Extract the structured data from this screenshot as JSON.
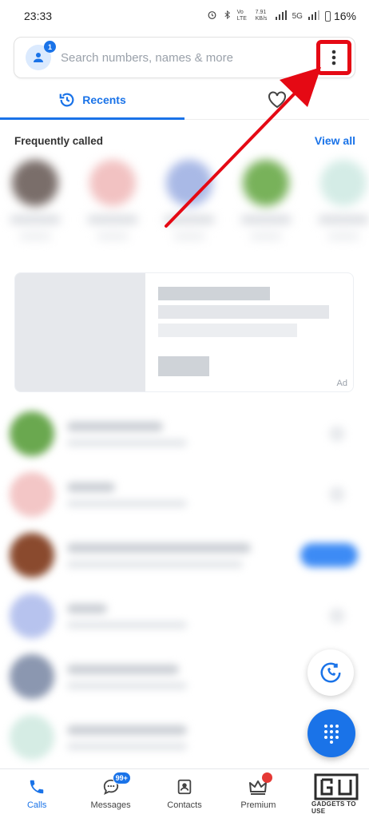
{
  "status_bar": {
    "time": "23:33",
    "network_speed": "7.91\nKB/s",
    "lte_label": "Vo LTE",
    "five_g": "5G",
    "battery": "16%"
  },
  "search": {
    "placeholder": "Search numbers, names & more",
    "profile_badge": "1"
  },
  "tabs": [
    {
      "label": "Recents",
      "active": true
    }
  ],
  "frequently_called": {
    "title": "Frequently called",
    "view_all": "View all"
  },
  "ad": {
    "label": "Ad"
  },
  "bottom_nav": [
    {
      "label": "Calls",
      "active": true
    },
    {
      "label": "Messages",
      "badge": "99+"
    },
    {
      "label": "Contacts"
    },
    {
      "label": "Premium"
    }
  ],
  "watermark": {
    "text": "GADGETS TO USE"
  },
  "colors": {
    "accent": "#1a73e8",
    "highlight": "#e50914"
  }
}
